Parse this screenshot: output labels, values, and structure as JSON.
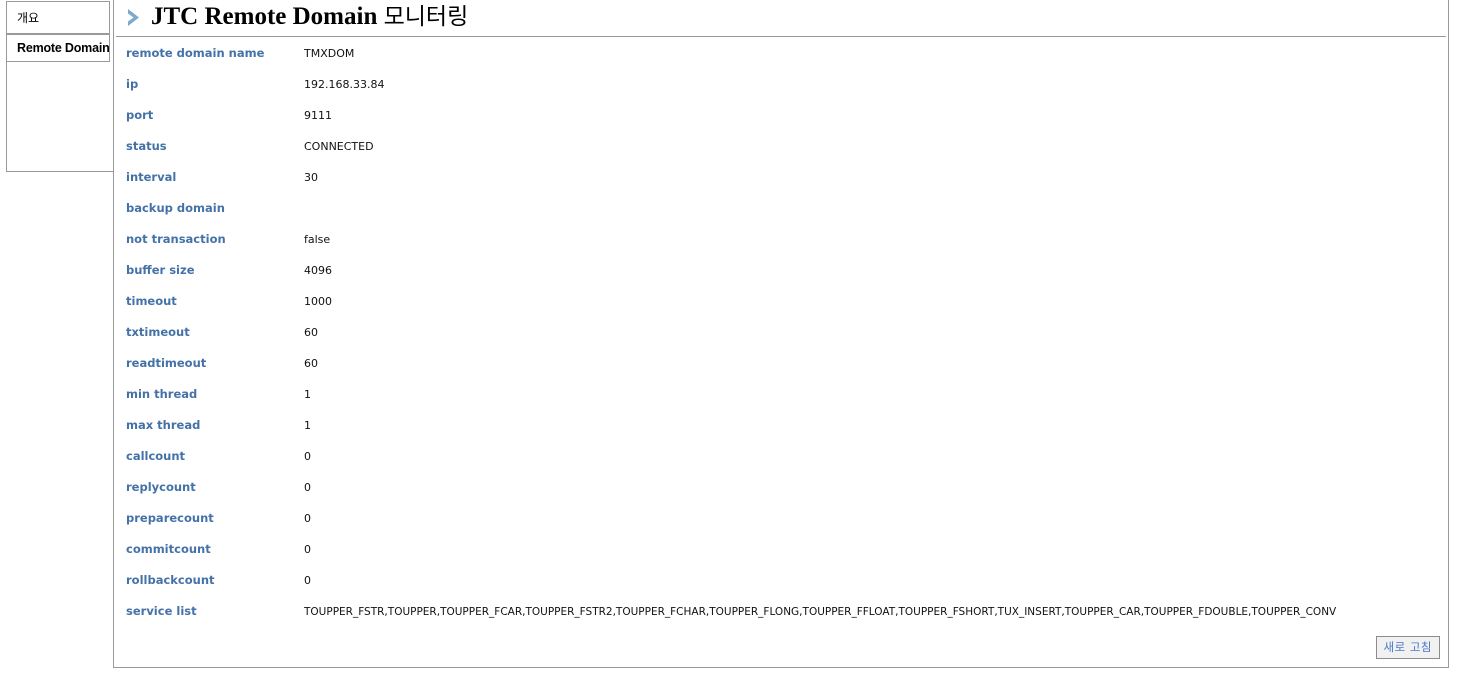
{
  "sidebar": {
    "tabs": [
      {
        "label": "개요",
        "selected": false
      },
      {
        "label": "Remote Domain",
        "selected": true
      }
    ]
  },
  "header": {
    "icon": "chevron-right-icon",
    "title_main": "JTC Remote Domain",
    "title_suffix": "모니터링",
    "accent_color": "#7fa8c9"
  },
  "details": {
    "label_color": "#4472a8",
    "rows": [
      {
        "label": "remote domain name",
        "value": "TMXDOM"
      },
      {
        "label": "ip",
        "value": "192.168.33.84"
      },
      {
        "label": "port",
        "value": "9111"
      },
      {
        "label": "status",
        "value": "CONNECTED"
      },
      {
        "label": "interval",
        "value": "30"
      },
      {
        "label": "backup domain",
        "value": ""
      },
      {
        "label": "not transaction",
        "value": "false"
      },
      {
        "label": "buffer size",
        "value": "4096"
      },
      {
        "label": "timeout",
        "value": "1000"
      },
      {
        "label": "txtimeout",
        "value": "60"
      },
      {
        "label": "readtimeout",
        "value": "60"
      },
      {
        "label": "min thread",
        "value": "1"
      },
      {
        "label": "max thread",
        "value": "1"
      },
      {
        "label": "callcount",
        "value": "0"
      },
      {
        "label": "replycount",
        "value": "0"
      },
      {
        "label": "preparecount",
        "value": "0"
      },
      {
        "label": "commitcount",
        "value": "0"
      },
      {
        "label": "rollbackcount",
        "value": "0"
      },
      {
        "label": "service list",
        "value": "TOUPPER_FSTR,TOUPPER,TOUPPER_FCAR,TOUPPER_FSTR2,TOUPPER_FCHAR,TOUPPER_FLONG,TOUPPER_FFLOAT,TOUPPER_FSHORT,TUX_INSERT,TOUPPER_CAR,TOUPPER_FDOUBLE,TOUPPER_CONV"
      }
    ]
  },
  "footer": {
    "refresh_label": "새로 고침"
  }
}
